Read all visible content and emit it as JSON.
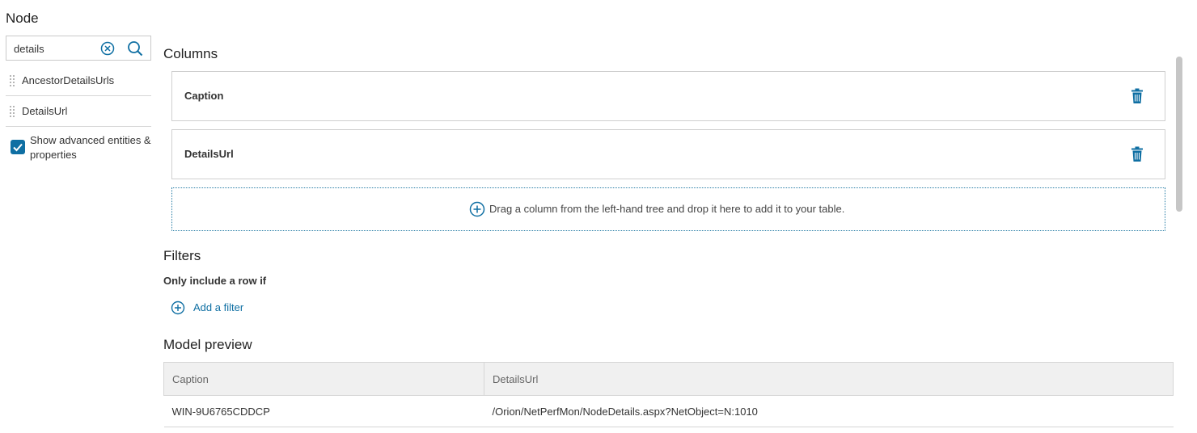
{
  "left": {
    "entity_title": "Node",
    "search": {
      "value": "details",
      "placeholder": "Search"
    },
    "properties": [
      {
        "label": "AncestorDetailsUrls"
      },
      {
        "label": "DetailsUrl"
      }
    ],
    "advanced_checkbox": {
      "label": "Show advanced entities & properties",
      "checked": true
    }
  },
  "columns": {
    "title": "Columns",
    "items": [
      {
        "name": "Caption"
      },
      {
        "name": "DetailsUrl"
      }
    ],
    "drop_hint": "Drag a column from the left-hand tree and drop it here to add it to your table."
  },
  "filters": {
    "title": "Filters",
    "subtitle": "Only include a row if",
    "add_label": "Add a filter"
  },
  "preview": {
    "title": "Model preview",
    "headers": [
      "Caption",
      "DetailsUrl"
    ],
    "rows": [
      [
        "WIN-9U6765CDDCP",
        "/Orion/NetPerfMon/NodeDetails.aspx?NetObject=N:1010"
      ]
    ]
  },
  "colors": {
    "accent": "#0f6fa3",
    "border": "#cfcfcf",
    "header_bg": "#f0f0f0"
  }
}
